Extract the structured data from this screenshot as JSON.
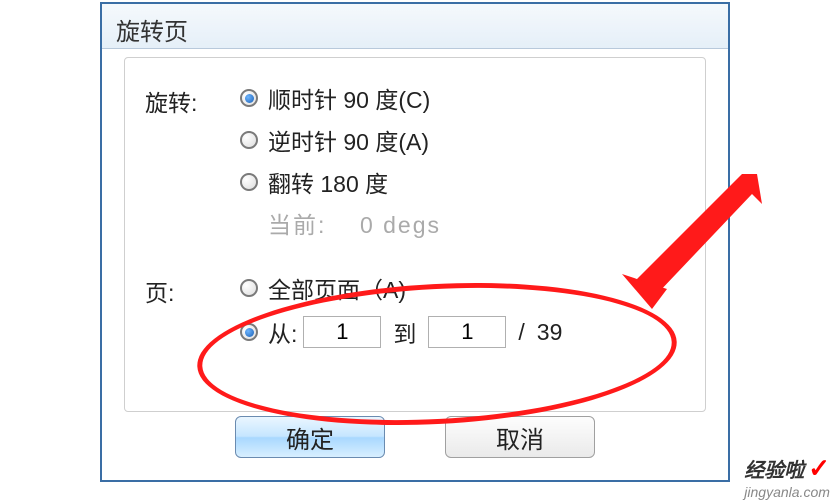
{
  "dialog": {
    "title": "旋转页",
    "rotate": {
      "label": "旋转:",
      "options": {
        "cw90": "顺时针 90 度(C)",
        "ccw90": "逆时针 90 度(A)",
        "flip180": "翻转 180 度"
      },
      "current_label": "当前:",
      "current_value": "0 degs"
    },
    "pages": {
      "label": "页:",
      "all_label": "全部页面（A)",
      "from_label": "从:",
      "from_value": "1",
      "to_label": "到",
      "to_value": "1",
      "slash": "/",
      "total": "39"
    },
    "buttons": {
      "ok": "确定",
      "cancel": "取消"
    }
  },
  "watermark": {
    "text_cn": "经验啦",
    "check": "✓",
    "url": "jingyanla.com"
  }
}
